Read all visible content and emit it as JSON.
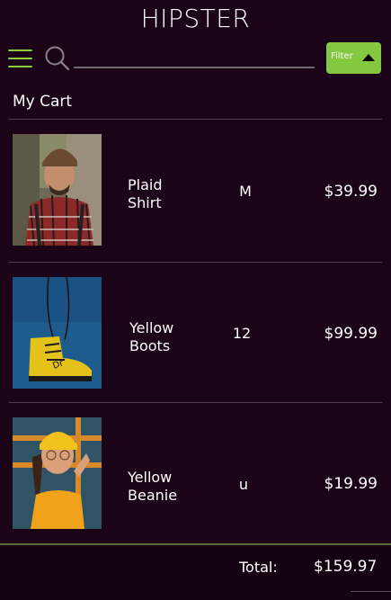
{
  "app": {
    "title": "HIPSTER"
  },
  "search": {
    "placeholder": "",
    "value": ""
  },
  "filter": {
    "label": "Filter"
  },
  "cart": {
    "heading": "My Cart",
    "items": [
      {
        "name_line1": "Plaid",
        "name_line2": "Shirt",
        "size": "M",
        "price": "$39.99"
      },
      {
        "name_line1": "Yellow",
        "name_line2": "Boots",
        "size": "12",
        "price": "$99.99"
      },
      {
        "name_line1": "Yellow",
        "name_line2": "Beanie",
        "size": "u",
        "price": "$19.99"
      }
    ],
    "total_label": "Total:",
    "total_value": "$159.97"
  },
  "colors": {
    "background": "#1b0418",
    "accent": "#84c83f",
    "divider": "#4d3f4b"
  },
  "icons": {
    "menu": "hamburger-menu-icon",
    "search": "search-icon",
    "filter": "caret-up-icon"
  }
}
